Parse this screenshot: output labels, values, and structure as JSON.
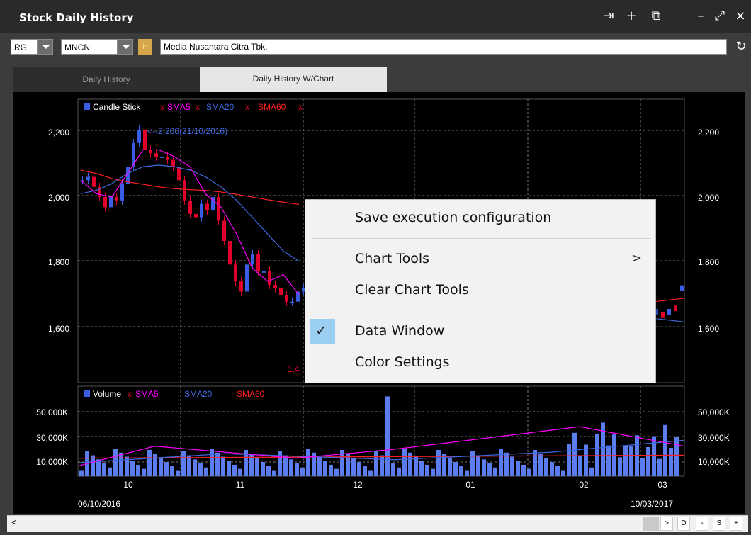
{
  "window": {
    "title": "Stock Daily History"
  },
  "title_icons": {
    "export": "⇥",
    "add": "+",
    "restore": "⧉",
    "minimize": "–",
    "expand": "⤢",
    "close": "×"
  },
  "toolbar": {
    "market": "RG",
    "ticker": "MNCN",
    "h_label": "H",
    "company": "Media Nusantara Citra Tbk.",
    "refresh": "↻"
  },
  "tabs": [
    {
      "label": "Daily History"
    },
    {
      "label": "Daily History W/Chart"
    }
  ],
  "chart": {
    "legend": {
      "candle": "Candle Stick",
      "sma5": "SMA5",
      "sma20": "SMA20",
      "sma60": "SMA60",
      "x": "x"
    },
    "volume_legend": {
      "volume": "Volume",
      "sma5": "SMA5",
      "sma20": "SMA20",
      "sma60": "SMA60",
      "x": "x"
    },
    "annotation": "<--2,200(21/10/2016)",
    "low_annotation": "1,4",
    "price_ticks": [
      "2,200",
      "2,000",
      "1,800",
      "1,600"
    ],
    "volume_ticks": [
      "50,000K",
      "30,000K",
      "10,000K"
    ],
    "x_ticks": [
      "10",
      "11",
      "12",
      "01",
      "02",
      "03"
    ],
    "start_date": "06/10/2016",
    "end_date": "10/03/2017",
    "colors": {
      "up": "#3b5ce4",
      "down": "#e0002a",
      "sma5": "#ff00ff",
      "sma20": "#4169e1",
      "sma60": "#ff2020",
      "volume": "#5b7df0"
    }
  },
  "context_menu": {
    "items": [
      "Save execution configuration",
      "Chart Tools",
      "Clear Chart Tools",
      "Data Window",
      "Color Settings"
    ],
    "submenu_arrow": ">",
    "check": "✓"
  },
  "bottombar": {
    "left": "<",
    "right": ">",
    "d": "D",
    "minus": "-",
    "s": "S",
    "plus": "+"
  }
}
